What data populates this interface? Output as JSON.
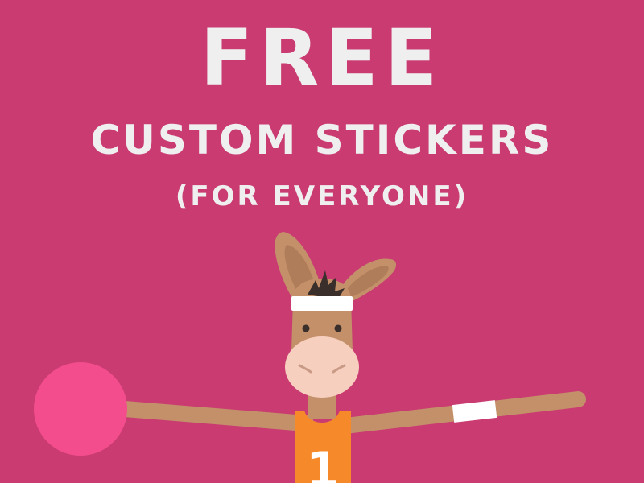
{
  "headline": {
    "main": "FREE",
    "sub": "CUSTOM STICKERS",
    "paren": "(FOR EVERYONE)"
  },
  "illustration": {
    "jersey_number": "1"
  },
  "colors": {
    "background": "#c93b71",
    "text": "#efefef",
    "ball": "#f34d8e",
    "fur": "#c3906a",
    "muzzle": "#f7cfbf",
    "jersey": "#f68a2b",
    "hair": "#3a2f2b",
    "sweatband": "#ffffff"
  }
}
